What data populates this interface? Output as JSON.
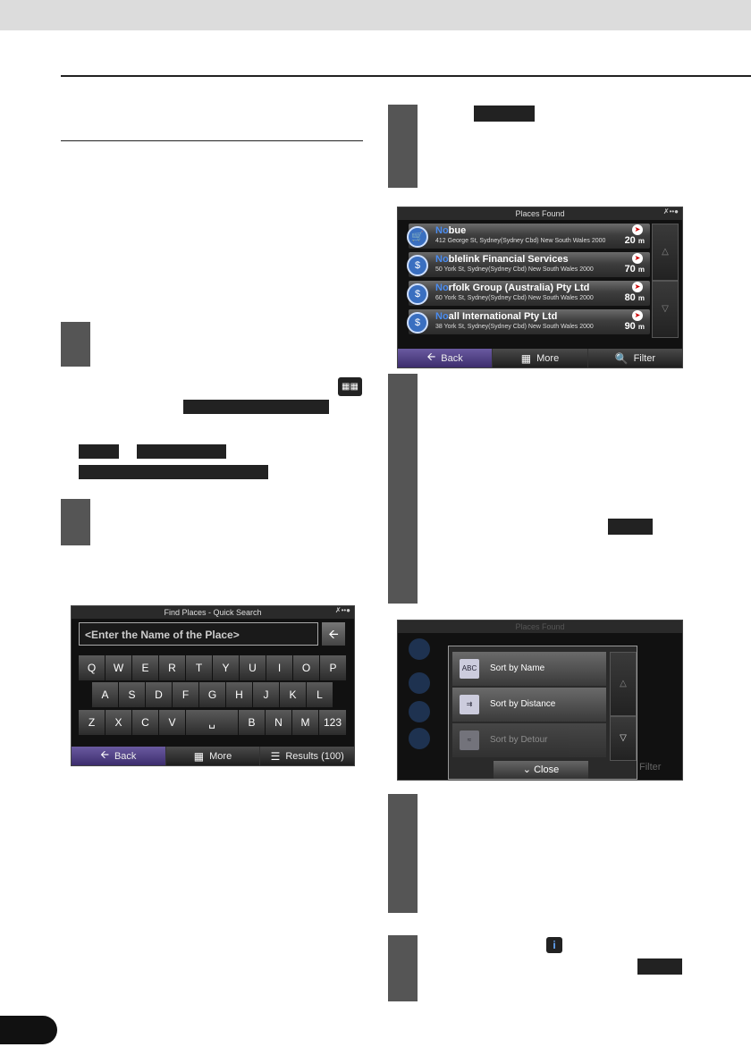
{
  "screens": {
    "places_found": {
      "title": "Places Found",
      "results": [
        {
          "name_hl": "No",
          "name_rest": "bue",
          "address": "412 George St, Sydney(Sydney Cbd) New South Wales 2000",
          "distance": "20",
          "unit": "m",
          "icon": "shopping-pin-icon"
        },
        {
          "name_hl": "No",
          "name_rest": "blelink Financial Services",
          "address": "50 York St, Sydney(Sydney Cbd) New South Wales 2000",
          "distance": "70",
          "unit": "m",
          "icon": "bank-pin-icon"
        },
        {
          "name_hl": "No",
          "name_rest": "rfolk Group (Australia) Pty Ltd",
          "address": "60 York St, Sydney(Sydney Cbd) New South Wales 2000",
          "distance": "80",
          "unit": "m",
          "icon": "bank-pin-icon"
        },
        {
          "name_hl": "No",
          "name_rest": "all International Pty Ltd",
          "address": "38 York St, Sydney(Sydney Cbd) New South Wales 2000",
          "distance": "90",
          "unit": "m",
          "icon": "bank-pin-icon"
        }
      ],
      "toolbar": {
        "back": "Back",
        "more": "More",
        "filter": "Filter"
      }
    },
    "quick_search": {
      "title": "Find Places - Quick Search",
      "placeholder": "<Enter the Name of the Place>",
      "rows": [
        [
          "Q",
          "W",
          "E",
          "R",
          "T",
          "Y",
          "U",
          "I",
          "O",
          "P"
        ],
        [
          "A",
          "S",
          "D",
          "F",
          "G",
          "H",
          "J",
          "K",
          "L"
        ],
        [
          "Z",
          "X",
          "C",
          "V",
          "␣",
          "B",
          "N",
          "M",
          "123"
        ]
      ],
      "toolbar": {
        "back": "Back",
        "more": "More",
        "results": "Results (100)"
      }
    },
    "sort_popup": {
      "bg_title": "Places Found",
      "options": [
        "Sort by Name",
        "Sort by Distance",
        "Sort by Detour"
      ],
      "close": "Close",
      "bg_filter": "Filter"
    }
  },
  "colors": {
    "accent": "#4a8cf0",
    "back_button": "#5a4a90",
    "page_bg": "#ffffff"
  }
}
